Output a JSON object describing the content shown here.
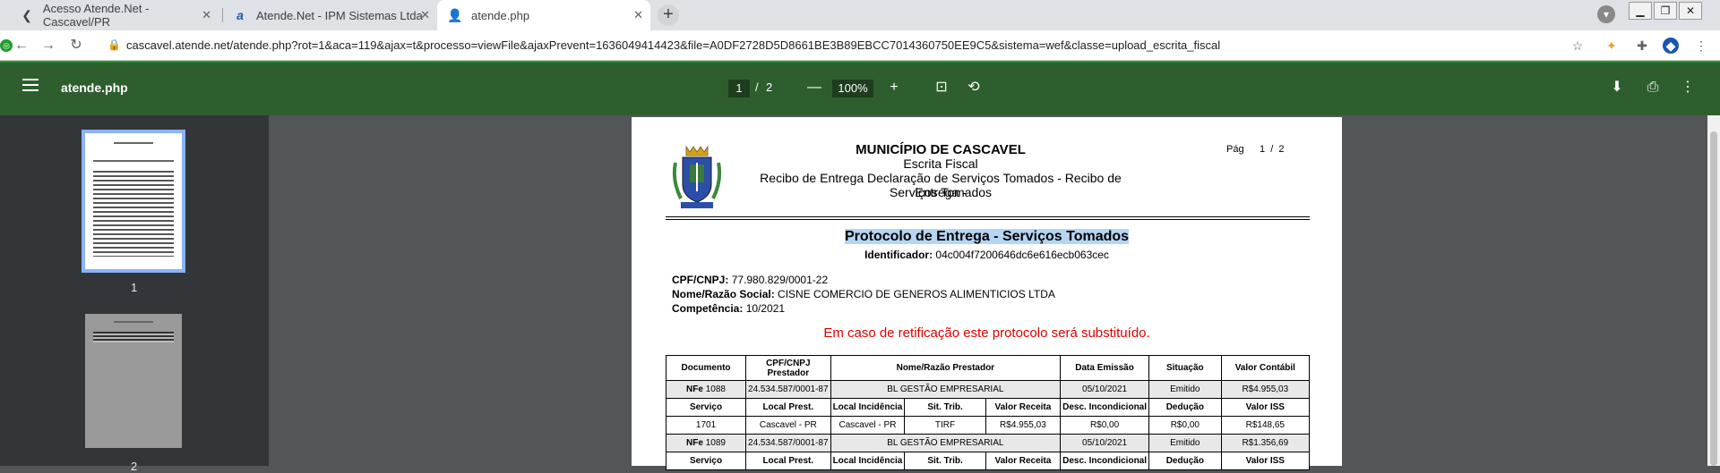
{
  "browser": {
    "tabs": [
      {
        "label": "Acesso Atende.Net - Cascavel/PR",
        "icon": "back-arrow-icon"
      },
      {
        "label": "Atende.Net - IPM Sistemas Ltda",
        "icon": "atende-logo-icon"
      },
      {
        "label": "atende.php",
        "icon": "user-icon"
      }
    ],
    "url": "cascavel.atende.net/atende.php?rot=1&aca=119&ajax=t&processo=viewFile&ajaxPrevent=1636049414423&file=A0DF2728D5D8661BE3B89EBCC7014360750EE9C5&sistema=wef&classe=upload_escrita_fiscal"
  },
  "viewer": {
    "title": "atende.php",
    "current_page": "1",
    "separator": "/",
    "total_pages": "2",
    "zoom": "100%"
  },
  "thumbnails": [
    {
      "label": "1"
    },
    {
      "label": "2"
    }
  ],
  "document": {
    "municipio": "MUNICÍPIO DE CASCAVEL",
    "escrita": "Escrita Fiscal",
    "recibo_line1": "Recibo de Entrega Declaração de Serviços Tomados - Recibo de Entrega -",
    "recibo_line2": "Serviços Tomados",
    "pag_label": "Pág",
    "pag_value": "1  /  2",
    "protocolo": "Protocolo de Entrega - Serviços Tomados",
    "identificador_label": "Identificador:",
    "identificador_value": "04c004f7200646dc6e616ecb063cec",
    "cpf_label": "CPF/CNPJ:",
    "cpf_value": "77.980.829/0001-22",
    "nome_label": "Nome/Razão Social:",
    "nome_value": "CISNE COMERCIO DE GENEROS ALIMENTICIOS LTDA",
    "competencia_label": "Competência:",
    "competencia_value": "10/2021",
    "aviso": "Em caso de retificação este protocolo será substituído.",
    "table_headers": [
      "Documento",
      "CPF/CNPJ Prestador",
      "Nome/Razão Prestador",
      "Data Emissão",
      "Situação",
      "Valor Contábil"
    ],
    "sub_headers": [
      "Serviço",
      "Local Prest.",
      "Local Incidência",
      "Sit. Trib.",
      "Valor Receita",
      "Desc. Incondicional",
      "Dedução",
      "Valor ISS"
    ],
    "rows": [
      {
        "nfe": "NFe",
        "doc": "1088",
        "cnpj": "24.534.587/0001-87",
        "nome": "BL GESTÃO EMPRESARIAL",
        "data": "05/10/2021",
        "situacao": "Emitido",
        "valor": "R$4.955,03",
        "servico": [
          "1701",
          "Cascavel - PR",
          "Cascavel - PR",
          "TIRF",
          "R$4.955,03",
          "R$0,00",
          "R$0,00",
          "R$148,65"
        ]
      },
      {
        "nfe": "NFe",
        "doc": "1089",
        "cnpj": "24.534.587/0001-87",
        "nome": "BL GESTÃO EMPRESARIAL",
        "data": "05/10/2021",
        "situacao": "Emitido",
        "valor": "R$1.356,69",
        "servico": [
          "",
          "",
          "",
          "",
          "",
          "",
          "",
          ""
        ]
      }
    ]
  },
  "colors": {
    "viewer_bar": "#2e5e2e",
    "accent_green": "#1f9d2a",
    "warning": "#e00000",
    "highlight": "#b5d5f3"
  }
}
